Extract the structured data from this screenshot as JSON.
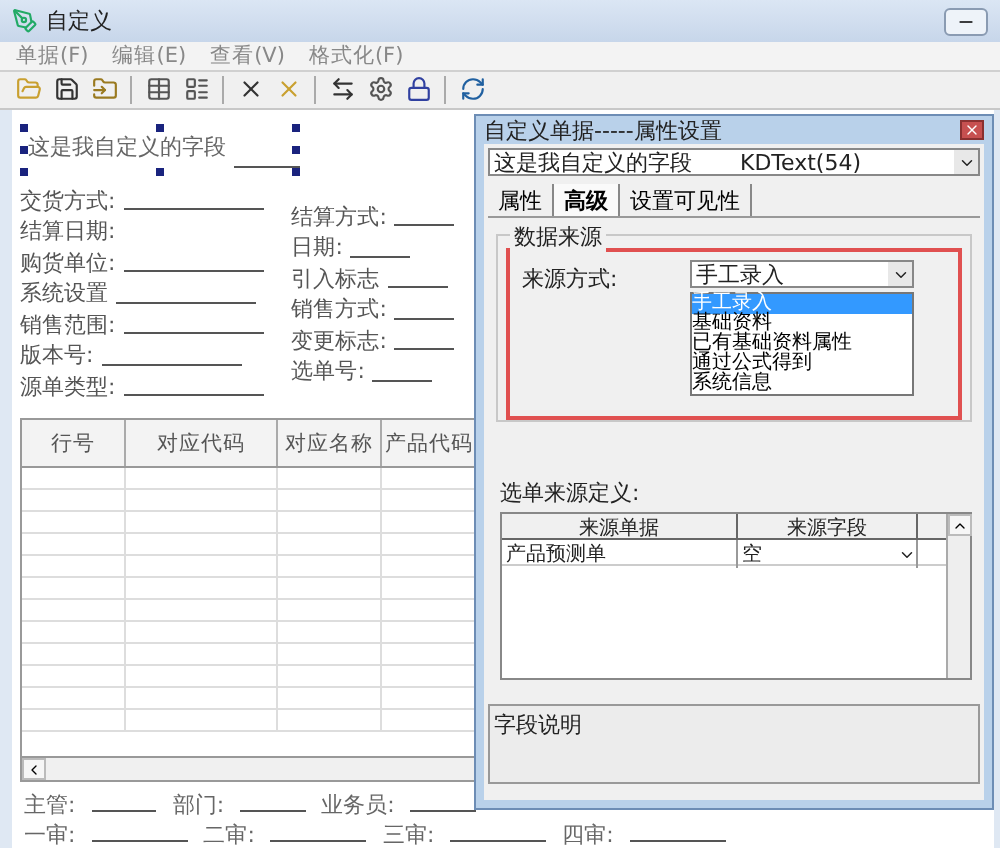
{
  "window": {
    "title": "自定义",
    "menu": [
      "单据(F)",
      "编辑(E)",
      "查看(V)",
      "格式化(F)"
    ]
  },
  "form": {
    "custom_field": {
      "label": "这是我自定义的字段",
      "selected": true
    },
    "left_fields": [
      {
        "label": "交货方式:",
        "kind": "field"
      },
      {
        "label": "结算日期:",
        "kind": "label"
      },
      {
        "label": "购货单位:",
        "kind": "field"
      },
      {
        "label": "系统设置",
        "kind": "field"
      },
      {
        "label": "销售范围:",
        "kind": "field"
      },
      {
        "label": "版本号:",
        "kind": "field"
      },
      {
        "label": "源单类型:",
        "kind": "field"
      }
    ],
    "right_fields": [
      {
        "label": "结算方式:",
        "kind": "field"
      },
      {
        "label": "日期:",
        "kind": "field"
      },
      {
        "label": "引入标志",
        "kind": "field"
      },
      {
        "label": "销售方式:",
        "kind": "field"
      },
      {
        "label": "变更标志:",
        "kind": "field"
      },
      {
        "label": "选单号:",
        "kind": "field"
      }
    ],
    "table": {
      "columns": [
        "行号",
        "对应代码",
        "对应名称",
        "产品代码"
      ]
    },
    "footer": [
      [
        "主管:",
        "部门:",
        "业务员:"
      ],
      [
        "一审:",
        "二审:",
        "三审:",
        "四审:"
      ]
    ]
  },
  "dialog": {
    "title": "自定义单据-----属性设置",
    "object": {
      "name": "这是我自定义的字段",
      "type": "KDText(54)"
    },
    "tabs": [
      {
        "label": "属性",
        "selected": false
      },
      {
        "label": "高级",
        "selected": true
      },
      {
        "label": "设置可见性",
        "selected": false
      }
    ],
    "group": "数据来源",
    "source_label": "来源方式:",
    "source_value": "手工录入",
    "options": [
      {
        "label": "手工录入",
        "selected": true
      },
      {
        "label": "基础资料",
        "selected": false
      },
      {
        "label": "已有基础资料属性",
        "selected": false
      },
      {
        "label": "通过公式得到",
        "selected": false
      },
      {
        "label": "系统信息",
        "selected": false
      }
    ],
    "picking": {
      "label": "选单来源定义:",
      "columns": [
        "来源单据",
        "来源字段"
      ],
      "rows": [
        [
          "产品预测单",
          "空"
        ]
      ]
    },
    "field_note": "字段说明"
  }
}
